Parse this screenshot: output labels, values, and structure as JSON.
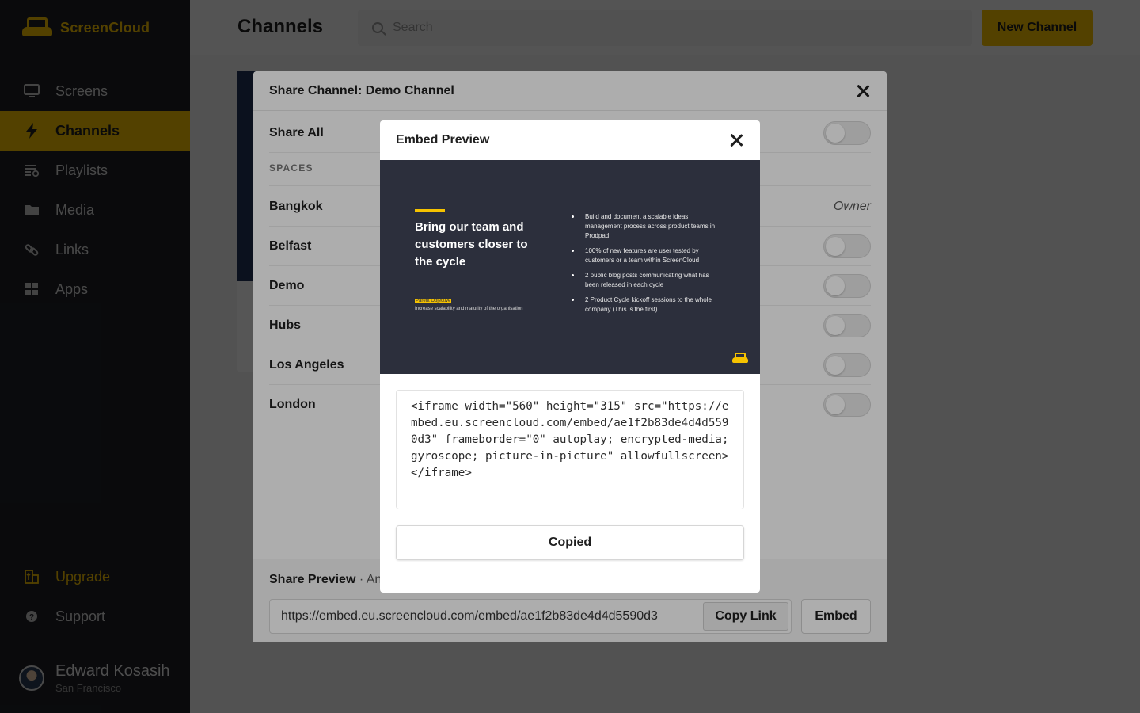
{
  "app": {
    "name": "ScreenCloud"
  },
  "sidebar": {
    "items": [
      {
        "label": "Screens",
        "icon": "monitor-icon"
      },
      {
        "label": "Channels",
        "icon": "lightning-icon",
        "active": true
      },
      {
        "label": "Playlists",
        "icon": "playlist-icon"
      },
      {
        "label": "Media",
        "icon": "folder-icon"
      },
      {
        "label": "Links",
        "icon": "link-icon"
      },
      {
        "label": "Apps",
        "icon": "grid-icon"
      }
    ],
    "upgrade": "Upgrade",
    "support": "Support",
    "user": {
      "name": "Edward Kosasih",
      "location": "San Francisco"
    }
  },
  "header": {
    "title": "Channels",
    "search_placeholder": "Search",
    "new_channel": "New Channel"
  },
  "share_modal": {
    "title": "Share Channel: Demo Channel",
    "share_all": "Share All",
    "spaces_label": "SPACES",
    "spaces": [
      {
        "name": "Bangkok",
        "owner": "Owner"
      },
      {
        "name": "Belfast"
      },
      {
        "name": "Demo"
      },
      {
        "name": "Hubs"
      },
      {
        "name": "Los Angeles"
      },
      {
        "name": "London"
      }
    ],
    "preview_label": "Share Preview",
    "preview_sub": "· An",
    "link": "https://embed.eu.screencloud.com/embed/ae1f2b83de4d4d5590d3",
    "copy_link": "Copy Link",
    "embed": "Embed"
  },
  "embed_modal": {
    "title": "Embed Preview",
    "slide": {
      "headline": "Bring our team and customers closer to the cycle",
      "objective_tag": "Parent Objective",
      "objective_desc": "Increase scalability and maturity of the organisation",
      "bullets": [
        "Build and document a scalable ideas management process across product teams in Prodpad",
        "100% of new features are user tested by customers or a team within ScreenCloud",
        "2 public blog posts communicating what has been released in each cycle",
        "2 Product Cycle kickoff sessions to the whole company (This is the first)"
      ]
    },
    "code": "<iframe width=\"560\" height=\"315\" src=\"https://embed.eu.screencloud.com/embed/ae1f2b83de4d4d5590d3\" frameborder=\"0\" autoplay; encrypted-media; gyroscope; picture-in-picture\" allowfullscreen></iframe>",
    "copied": "Copied"
  },
  "colors": {
    "brand": "#f6c300",
    "sidebar": "#1f2027",
    "slide_bg": "#2c2f3c"
  }
}
